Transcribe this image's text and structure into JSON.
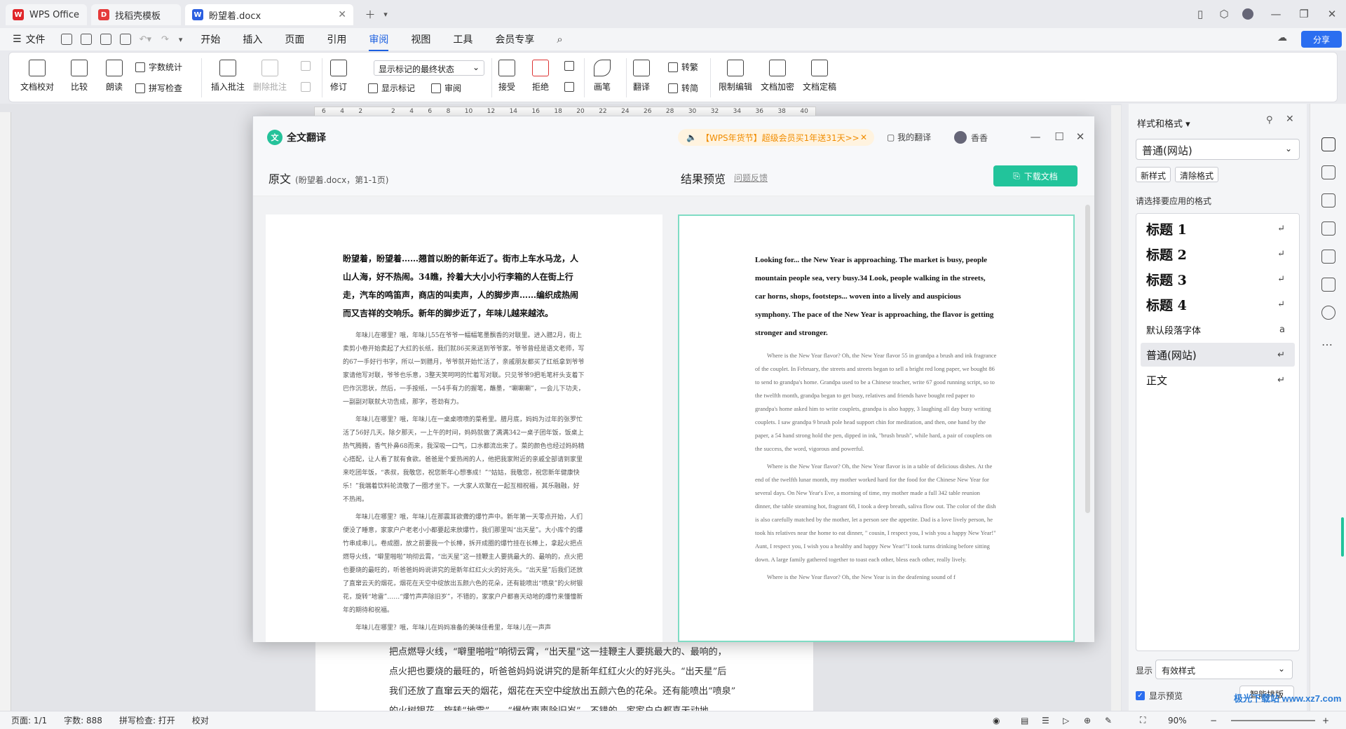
{
  "titlebar": {
    "tabs": [
      {
        "label": "WPS Office",
        "icon": "wps-logo-icon"
      },
      {
        "label": "找稻壳模板",
        "icon": "docer-icon"
      },
      {
        "label": "盼望着.docx",
        "icon": "word-doc-icon"
      }
    ]
  },
  "menubar": {
    "file": "文件",
    "items": [
      "开始",
      "插入",
      "页面",
      "引用",
      "审阅",
      "视图",
      "工具",
      "会员专享"
    ],
    "active": "审阅",
    "share": "分享"
  },
  "ribbon": {
    "proofread": "文档校对",
    "compare": "比较",
    "read_aloud": "朗读",
    "word_count": "字数统计",
    "spell_check": "拼写检查",
    "insert_comment": "插入批注",
    "delete_comment": "删除批注",
    "track": "修订",
    "show_markup_select": "显示标记的最终状态",
    "show_markup": "显示标记",
    "review": "审阅",
    "accept": "接受",
    "reject": "拒绝",
    "pen": "画笔",
    "translate": "翻译",
    "to_traditional": "转繁",
    "to_simplified": "转简",
    "restrict_edit": "限制编辑",
    "encrypt": "文档加密",
    "finalize": "文档定稿"
  },
  "ruler": {
    "ticks": [
      "6",
      "4",
      "2",
      "",
      "2",
      "4",
      "6",
      "8",
      "10",
      "12",
      "14",
      "16",
      "18",
      "20",
      "22",
      "24",
      "26",
      "28",
      "30",
      "32",
      "34",
      "36",
      "38",
      "40"
    ]
  },
  "document": {
    "lines": [
      "把点燃导火线，“噼里啪啦”响彻云霄，“出天星”这一挂鞭主人要挑最大的、最响的，",
      "点火把也要烧的最旺的，听爸爸妈妈说讲究的是新年红红火火的好兆头。“出天星”后",
      "我们还放了直窜云天的烟花，烟花在天空中绽放出五颜六色的花朵。还有能喷出“喷泉”",
      "的火树银花，旋转“地雷”……“爆竹声声除旧岁”，不错的，家家户户都喜天动地"
    ]
  },
  "dialog": {
    "title": "全文翻译",
    "promo": "【WPS年货节】超级会员买1年送31天>>",
    "my_translations": "我的翻译",
    "user": "香香",
    "original_label": "原文",
    "original_meta": "(盼望着.docx，第1-1页)",
    "result_label": "结果预览",
    "feedback": "问题反馈",
    "download": "下载文档",
    "cn_title": "盼望着，盼望着……翘首以盼的新年近了。街市上车水马龙，人山人海，好不热闹。34瞧，拎着大大小小行李箱的人在街上行走，汽车的鸣笛声，商店的叫卖声，人的脚步声……编织成热闹而又吉祥的交响乐。新年的脚步近了，年味儿越来越浓。",
    "cn_paras": [
      "年味儿在哪里？哦，年味儿55在爷爷一幅幅笔墨飘香的对联里。进入腊2月，街上卖剪小卷开始卖起了大红的长纸，我们就86买来送到爷爷家。爷爷曾经是语文老师，写的67一手好行书字，所以一到腊月，爷爷就开始忙活了，亲戚朋友都买了红纸拿到爷爷家请他写对联，爷爷也乐意，3整天笑呵呵的忙着写对联。只见爷爷9把毛笔杆头支着下巴作沉思状，然后，一手按纸，一54手有力的握笔，蘸墨，“唰唰唰”，一会儿下功夫，一副副对联就大功告成，那字，苍劲有力。",
      "年味儿在哪里？哦，年味儿在一桌桌喷喷的菜肴里。腊月底，妈妈为过年的张罗忙活了56好几天。除夕那天，一上午的时间，妈妈就做了满满342一桌子团年饭，饭桌上热气腾腾，香气扑鼻68而来，我深吸一口气，口水都流出来了。菜的颜色也经过妈妈精心搭配，让人看了就有食欲。爸爸是个爱热闹的人，他把我家附近的亲戚全部请到家里来吃团年饭，“表叔，我敬您，祝您新年心想事成！”“姑姑，我敬您，祝您新年健康快乐！”我端着饮料轮流敬了一圈才坐下。一大家人欢聚在一起互相祝福，其乐融融，好不热闹。",
      "年味儿在哪里？哦，年味儿在那震耳欲聋的爆竹声中。新年第一天零点开始，人们便没了睡意，家家户户老老小小都要起来放爆竹，我们那里叫“出天星”。大小库个的爆竹串成串儿，卷成圈，放之前要我一个长棒，拆开成圈的爆竹挂在长棒上，拿起火把点燃导火线，“噼里啪啦”响彻云霄，“出天星”这一挂鞭主人要挑最大的、最响的，点火把也要烧的最旺的，听爸爸妈妈说讲究的是新年红红火火的好兆头。“出天星”后我们还放了直窜云天的烟花，烟花在天空中绽放出五颜六色的花朵，还有能喷出“喷泉”的火树银花，旋转“地雷”……“爆竹声声除旧岁”，不错的，家家户户都喜天动地的爆竹来懂憧新年的期待和祝福。",
      "年味儿在哪里？哦，年味儿在妈妈准备的美味佳肴里，年味儿在一声声"
    ],
    "en_title": "Looking for... the New Year is approaching. The market is busy, people mountain people sea, very busy.34 Look, people walking in the streets, car horns, shops, footsteps... woven into a lively and auspicious symphony. The pace of the New Year is approaching, the flavor is getting stronger and stronger.",
    "en_paras": [
      "Where is the New Year flavor? Oh, the New Year flavor 55 in grandpa a brush and ink fragrance of the couplet. In February, the streets and streets began to sell a bright red long paper, we bought 86 to send to grandpa's home. Grandpa used to be a Chinese teacher, write 67 good running script, so to the twelfth month, grandpa began to get busy, relatives and friends have bought red paper to grandpa's home asked him to write couplets, grandpa is also happy, 3 laughing all day busy writing couplets. I saw grandpa 9 brush pole head support chin for meditation, and then, one hand by the paper, a 54 hand strong hold the pen, dipped in ink, \"brush brush\", while hard, a pair of couplets on the success, the word, vigorous and powerful.",
      "Where is the New Year flavor? Oh, the New Year flavor is in a table of delicious dishes. At the end of the twelfth lunar month, my mother worked hard for the food for the Chinese New Year for several days. On New Year's Eve, a morning of time, my mother made a full 342 table reunion dinner, the table steaming hot, fragrant 68, I took a deep breath, saliva flow out. The color of the dish is also carefully matched by the mother, let a person see the appetite. Dad is a love lively person, he took his relatives near the home to eat dinner, \" cousin, I respect you, I wish you a happy New Year!\" Aunt, I respect you, I wish you a healthy and happy New Year!\"I took turns drinking before sitting down. A large family gathered together to toast each other, bless each other, really lively.",
      "Where is the New Year flavor? Oh, the New Year is in the deafening sound of f"
    ]
  },
  "stylepanel": {
    "title": "样式和格式",
    "current": "普通(网站)",
    "new_style": "新样式",
    "clear_format": "清除格式",
    "choose_label": "请选择要应用的格式",
    "styles": [
      {
        "name": "标题  1",
        "mark": "↵"
      },
      {
        "name": "标题  2",
        "mark": "↵"
      },
      {
        "name": "标题  3",
        "mark": "↵"
      },
      {
        "name": "标题  4",
        "mark": "↵"
      },
      {
        "name": "默认段落字体",
        "mark": "a"
      },
      {
        "name": "普通(网站)",
        "mark": "↵"
      },
      {
        "name": "正文",
        "mark": "↵"
      }
    ],
    "show_label": "显示",
    "show_value": "有效样式",
    "preview": "显示预览",
    "smart_layout": "智能排版"
  },
  "statusbar": {
    "page": "页面: 1/1",
    "words": "字数: 888",
    "spell": "拼写检查: 打开",
    "proof": "校对",
    "zoom": "90%"
  },
  "watermark": "极光下载站 www.xz7.com",
  "colors": {
    "accent": "#1b5fe0",
    "green": "#22c49b",
    "promo": "#f08c00"
  }
}
